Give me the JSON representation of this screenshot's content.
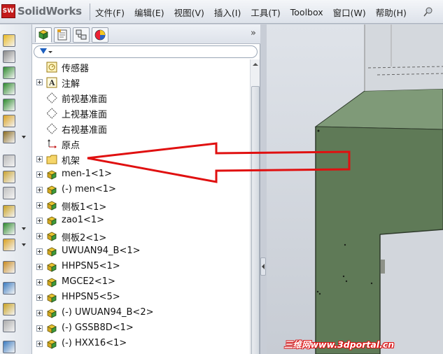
{
  "app": {
    "logo_text": "SolidWorks",
    "logo_badge": "SW"
  },
  "menu": {
    "items": [
      "文件(F)",
      "编辑(E)",
      "视图(V)",
      "插入(I)",
      "工具(T)",
      "Toolbox",
      "窗口(W)",
      "帮助(H)"
    ]
  },
  "feature_tree": {
    "items": [
      {
        "label": "传感器",
        "icon": "sensor-icon",
        "expandable": false
      },
      {
        "label": "注解",
        "icon": "annotation-icon",
        "expandable": true
      },
      {
        "label": "前视基准面",
        "icon": "plane-icon",
        "expandable": false
      },
      {
        "label": "上视基准面",
        "icon": "plane-icon",
        "expandable": false
      },
      {
        "label": "右视基准面",
        "icon": "plane-icon",
        "expandable": false
      },
      {
        "label": "原点",
        "icon": "origin-icon",
        "expandable": false
      },
      {
        "label": "机架",
        "icon": "folder-icon",
        "expandable": true
      },
      {
        "label": "men-1<1>",
        "icon": "part-icon",
        "expandable": true
      },
      {
        "label": "(-) men<1>",
        "icon": "part-icon",
        "expandable": true
      },
      {
        "label": "侧板1<1>",
        "icon": "part-icon",
        "expandable": true
      },
      {
        "label": "zao1<1>",
        "icon": "part-icon",
        "expandable": true
      },
      {
        "label": "侧板2<1>",
        "icon": "part-icon",
        "expandable": true
      },
      {
        "label": "UWUAN94_B<1>",
        "icon": "part-icon",
        "expandable": true
      },
      {
        "label": "HHPSN5<1>",
        "icon": "part-icon",
        "expandable": true
      },
      {
        "label": "MGCE2<1>",
        "icon": "part-icon",
        "expandable": true
      },
      {
        "label": "HHPSN5<5>",
        "icon": "part-icon",
        "expandable": true
      },
      {
        "label": "(-) UWUAN94_B<2>",
        "icon": "part-icon",
        "expandable": true
      },
      {
        "label": "(-) GSSB8D<1>",
        "icon": "part-icon",
        "expandable": true
      },
      {
        "label": "(-) HXX16<1>",
        "icon": "part-icon",
        "expandable": true
      }
    ]
  },
  "watermark": "三维网www.3dportal.cn",
  "colors": {
    "model_green": "#5f7a57",
    "arrow_red": "#e01010",
    "accent_blue": "#1d5fbf"
  }
}
